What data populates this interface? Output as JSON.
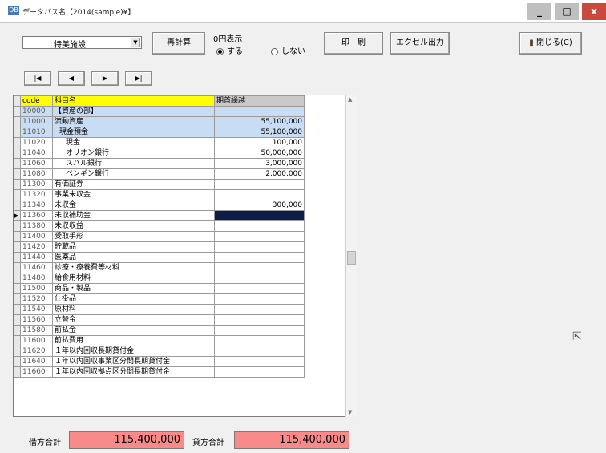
{
  "window": {
    "title": "データパス名【2014(sample)¥】",
    "minimize": "_",
    "maximize": "□",
    "close": "x"
  },
  "toolbar": {
    "select_value": "特美施設",
    "recalc_label": "再計算",
    "zero_group_label": "0円表示",
    "radio_yes": "する",
    "radio_no": "しない",
    "print_label": "印　刷",
    "excel_label": "エクセル出力",
    "close_label": "閉じる(C)"
  },
  "nav": {
    "first": "|◀",
    "prev": "◀",
    "next": "▶",
    "last": "▶|"
  },
  "table": {
    "headers": {
      "code": "code",
      "name": "科目名",
      "amount": "期首繰越"
    },
    "rows": [
      {
        "code": "10000",
        "name": "【資産の部】",
        "amount": ""
      },
      {
        "code": "11000",
        "name": "流動資産",
        "amount": "55,100,000"
      },
      {
        "code": "11010",
        "name": "現金預金",
        "amount": "55,100,000"
      },
      {
        "code": "11020",
        "name": "現金",
        "amount": "100,000"
      },
      {
        "code": "11040",
        "name": "オリオン銀行",
        "amount": "50,000,000"
      },
      {
        "code": "11060",
        "name": "スバル銀行",
        "amount": "3,000,000"
      },
      {
        "code": "11080",
        "name": "ペンギン銀行",
        "amount": "2,000,000"
      },
      {
        "code": "11300",
        "name": "有価証券",
        "amount": ""
      },
      {
        "code": "11320",
        "name": "事業未収金",
        "amount": ""
      },
      {
        "code": "11340",
        "name": "未収金",
        "amount": "300,000"
      },
      {
        "code": "11360",
        "name": "未収補助金",
        "amount": ""
      },
      {
        "code": "11380",
        "name": "未収収益",
        "amount": ""
      },
      {
        "code": "11400",
        "name": "受取手形",
        "amount": ""
      },
      {
        "code": "11420",
        "name": "貯蔵品",
        "amount": ""
      },
      {
        "code": "11440",
        "name": "医薬品",
        "amount": ""
      },
      {
        "code": "11460",
        "name": "診療・療養費等材料",
        "amount": ""
      },
      {
        "code": "11480",
        "name": "給食用材料",
        "amount": ""
      },
      {
        "code": "11500",
        "name": "商品・製品",
        "amount": ""
      },
      {
        "code": "11520",
        "name": "仕掛品",
        "amount": ""
      },
      {
        "code": "11540",
        "name": "原材料",
        "amount": ""
      },
      {
        "code": "11560",
        "name": "立替金",
        "amount": ""
      },
      {
        "code": "11580",
        "name": "前払金",
        "amount": ""
      },
      {
        "code": "11600",
        "name": "前払費用",
        "amount": ""
      },
      {
        "code": "11620",
        "name": "１年以内回収長期貸付金",
        "amount": ""
      },
      {
        "code": "11640",
        "name": "１年以内回収事業区分間長期貸付金",
        "amount": ""
      },
      {
        "code": "11660",
        "name": "１年以内回収拠点区分間長期貸付金",
        "amount": ""
      }
    ]
  },
  "footer": {
    "debit_label": "借方合計",
    "debit_value": "115,400,000",
    "credit_label": "貸方合計",
    "credit_value": "115,400,000"
  },
  "colors": {
    "yellow_header": "#ffff00",
    "highlight_row": "#c8dcf3",
    "selected_cell": "#0c1e48",
    "total_box": "#f88a8a"
  }
}
